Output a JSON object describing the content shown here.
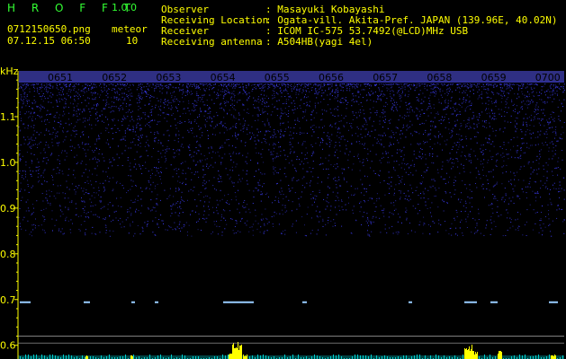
{
  "app": {
    "name": "H R O F F T",
    "version": "1.0.0"
  },
  "file": {
    "name": "0712150650.png",
    "datetime": "07.12.15 06:50"
  },
  "meteor": {
    "label": "meteor",
    "count": "10"
  },
  "info": [
    {
      "label": "Observer",
      "value": ": Masayuki Kobayashi"
    },
    {
      "label": "Receiving Location",
      "value": ": Ogata-vill. Akita-Pref. JAPAN (139.96E, 40.02N)"
    },
    {
      "label": "Receiver",
      "value": ": ICOM IC-575 53.7492(@LCD)MHz USB"
    },
    {
      "label": "Receiving antenna",
      "value": ": A504HB(yagi 4el)"
    }
  ],
  "chart_data": {
    "type": "heatmap",
    "ylabel": "kHz",
    "y_ticks": [
      "1.1",
      "1.0",
      "0.9",
      "0.8",
      "0.7",
      "0.6"
    ],
    "x_ticks": [
      "0651",
      "0652",
      "0653",
      "0654",
      "0655",
      "0656",
      "0657",
      "0658",
      "0659",
      "0700"
    ],
    "ylim": [
      0.57,
      1.2
    ],
    "xlim": [
      "0650",
      "0700"
    ],
    "colors": {
      "noise": "#2222cc",
      "trace": "#99ccff",
      "histogram": "#ffff00",
      "histogram_base": "#00cccc",
      "axis": "#ffff00"
    }
  }
}
